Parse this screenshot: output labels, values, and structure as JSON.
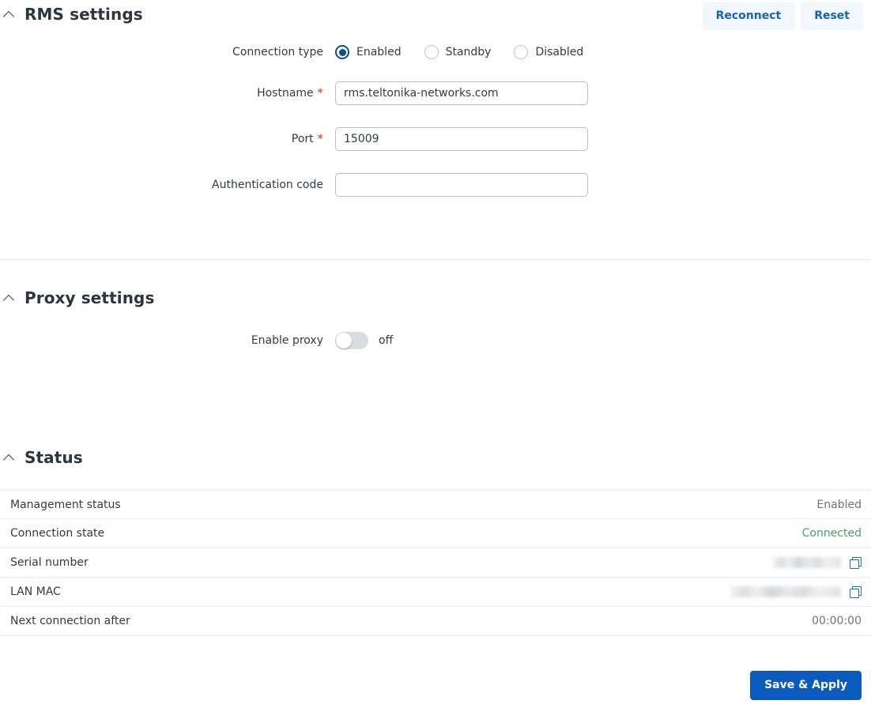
{
  "rms": {
    "title": "RMS settings",
    "collapse_icon": "chevron-up-icon",
    "reconnect_label": "Reconnect",
    "reset_label": "Reset",
    "connection_type": {
      "label": "Connection type",
      "selected": "Enabled",
      "options": [
        "Enabled",
        "Standby",
        "Disabled"
      ]
    },
    "hostname": {
      "label": "Hostname",
      "required_mark": "*",
      "value": "rms.teltonika-networks.com",
      "placeholder": ""
    },
    "port": {
      "label": "Port",
      "required_mark": "*",
      "value": "15009",
      "placeholder": ""
    },
    "auth_code": {
      "label": "Authentication code",
      "value": "",
      "placeholder": ""
    }
  },
  "proxy": {
    "title": "Proxy settings",
    "collapse_icon": "chevron-up-icon",
    "enable": {
      "label": "Enable proxy",
      "state_text": "off",
      "checked": false
    }
  },
  "status": {
    "title": "Status",
    "collapse_icon": "chevron-up-icon",
    "rows": [
      {
        "key": "Management status",
        "value": "Enabled",
        "style": "plain",
        "copy": false
      },
      {
        "key": "Connection state",
        "value": "Connected",
        "style": "green",
        "copy": false
      },
      {
        "key": "Serial number",
        "value": "",
        "style": "blurred",
        "copy": true,
        "blur_width": 86
      },
      {
        "key": "LAN MAC",
        "value": "",
        "style": "blurred",
        "copy": true,
        "blur_width": 140
      },
      {
        "key": "Next connection after",
        "value": "00:00:00",
        "style": "plain",
        "copy": false
      }
    ]
  },
  "footer": {
    "save_label": "Save & Apply"
  },
  "colors": {
    "accent": "#0a5bbd",
    "light_button_bg": "#f2f7fd",
    "light_button_text": "#1664b4",
    "radio_selected": "#0b4d8f",
    "connected_green": "#42a06a",
    "required_red": "#e0624a"
  }
}
